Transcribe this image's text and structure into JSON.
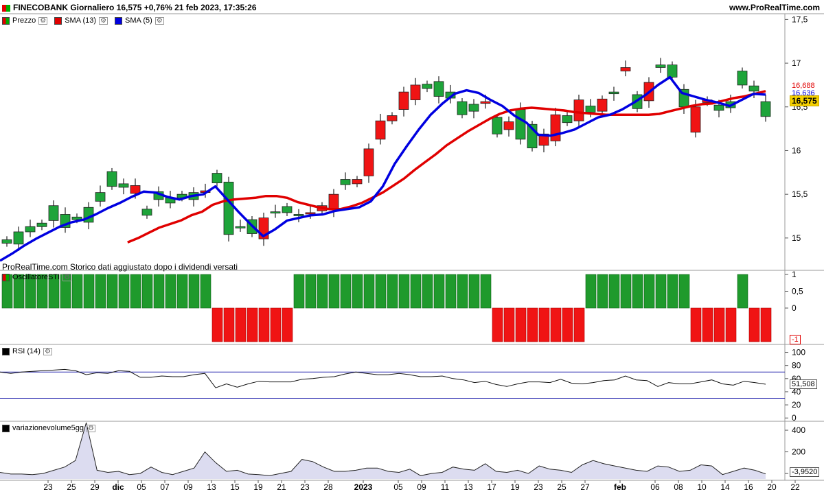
{
  "header": {
    "title": "FINECOBANK Giornaliero 16,575 +0,76% 21 feb 2023, 17:35:26",
    "site": "www.ProRealTime.com"
  },
  "legend": {
    "price": "Prezzo",
    "sma13": "SMA (13)",
    "sma5": "SMA (5)",
    "osc": "OscillatoreSTI",
    "rsi": "RSI (14)",
    "vol": "variazionevolume5gg"
  },
  "note": "ProRealTime.com  Storico dati aggiustato dopo i dividendi versati",
  "tags": {
    "sma13": "16,688",
    "sma5": "16,636",
    "last": "16,575",
    "osc": "-1",
    "rsi": "51,508",
    "vol": "-3,9520"
  },
  "chart_data": [
    {
      "type": "candlestick",
      "ylim": [
        14.63,
        17.55
      ],
      "yticks": [
        "17,5",
        "17",
        "16,5",
        "16",
        "15,5",
        "15"
      ],
      "ytick_values": [
        17.5,
        17.0,
        16.5,
        16.0,
        15.5,
        15.0
      ],
      "x_labels": [
        {
          "i": 2,
          "text": "23"
        },
        {
          "i": 4,
          "text": "25"
        },
        {
          "i": 6,
          "text": "29"
        },
        {
          "i": 8,
          "text": "dic",
          "bold": true
        },
        {
          "i": 10,
          "text": "05"
        },
        {
          "i": 12,
          "text": "07"
        },
        {
          "i": 14,
          "text": "09"
        },
        {
          "i": 16,
          "text": "13"
        },
        {
          "i": 18,
          "text": "15"
        },
        {
          "i": 20,
          "text": "19"
        },
        {
          "i": 22,
          "text": "21"
        },
        {
          "i": 24,
          "text": "23"
        },
        {
          "i": 26,
          "text": "28"
        },
        {
          "i": 29,
          "text": "2023",
          "bold": true
        },
        {
          "i": 32,
          "text": "05"
        },
        {
          "i": 34,
          "text": "09"
        },
        {
          "i": 36,
          "text": "11"
        },
        {
          "i": 38,
          "text": "13"
        },
        {
          "i": 40,
          "text": "17"
        },
        {
          "i": 42,
          "text": "19"
        },
        {
          "i": 44,
          "text": "23"
        },
        {
          "i": 46,
          "text": "25"
        },
        {
          "i": 48,
          "text": "27"
        },
        {
          "i": 51,
          "text": "feb",
          "bold": true
        },
        {
          "i": 54,
          "text": "06"
        },
        {
          "i": 56,
          "text": "08"
        },
        {
          "i": 58,
          "text": "10"
        },
        {
          "i": 60,
          "text": "14"
        },
        {
          "i": 62,
          "text": "16"
        },
        {
          "i": 64,
          "text": "20"
        },
        {
          "i": 66,
          "text": "22"
        }
      ],
      "open": [
        14.94,
        14.93,
        15.07,
        15.13,
        15.2,
        15.12,
        15.21,
        15.18,
        15.42,
        15.59,
        15.58,
        15.6,
        15.26,
        15.44,
        15.4,
        15.46,
        15.44,
        15.54,
        15.63,
        15.04,
        15.13,
        15.05,
        15.23,
        15.29,
        15.29,
        15.26,
        15.29,
        15.37,
        15.5,
        15.61,
        15.67,
        16.02,
        16.34,
        16.4,
        16.67,
        16.75,
        16.71,
        16.62,
        16.6,
        16.41,
        16.45,
        16.56,
        16.19,
        16.33,
        16.13,
        16.03,
        16.19,
        16.41,
        16.32,
        16.58,
        16.44,
        16.59,
        16.65,
        16.95,
        16.48,
        16.78,
        16.95,
        16.84,
        16.5,
        16.5,
        16.58,
        16.46,
        16.49,
        16.75,
        16.68,
        16.39
      ],
      "close": [
        14.98,
        15.07,
        15.13,
        15.17,
        15.37,
        15.27,
        15.24,
        15.35,
        15.52,
        15.76,
        15.62,
        15.51,
        15.33,
        15.53,
        15.46,
        15.5,
        15.52,
        15.52,
        15.74,
        15.64,
        15.13,
        15.21,
        14.99,
        15.3,
        15.36,
        15.27,
        15.28,
        15.31,
        15.32,
        15.67,
        15.62,
        15.71,
        16.13,
        16.34,
        16.47,
        16.58,
        16.76,
        16.79,
        16.67,
        16.56,
        16.53,
        16.54,
        16.38,
        16.24,
        16.47,
        16.3,
        16.06,
        16.11,
        16.4,
        16.34,
        16.51,
        16.45,
        16.67,
        16.91,
        16.64,
        16.57,
        16.98,
        16.98,
        16.7,
        16.21,
        16.55,
        16.52,
        16.56,
        16.91,
        16.74,
        16.56,
        16.41,
        16.57
      ]
    },
    {
      "type": "line",
      "series": [
        {
          "name": "SMA (13)",
          "color": "#e00000",
          "values": [
            null,
            null,
            null,
            null,
            null,
            null,
            null,
            null,
            null,
            null,
            null,
            null,
            14.95,
            15.0,
            15.06,
            15.12,
            15.16,
            15.2,
            15.26,
            15.3,
            15.38,
            15.42,
            15.44,
            15.45,
            15.46,
            15.48,
            15.48,
            15.46,
            15.41,
            15.38,
            15.35,
            15.33,
            15.33,
            15.36,
            15.4,
            15.46,
            15.52,
            15.6,
            15.68,
            15.78,
            15.87,
            15.96,
            16.06,
            16.14,
            16.22,
            16.29,
            16.36,
            16.42,
            16.46,
            16.48,
            16.49,
            16.48,
            16.47,
            16.46,
            16.44,
            16.43,
            16.42,
            16.41,
            16.41,
            16.41,
            16.41,
            16.41,
            16.42,
            16.45,
            16.48,
            16.51,
            16.53,
            16.54,
            16.57,
            16.6,
            16.62,
            16.65,
            16.68
          ]
        },
        {
          "name": "SMA (5)",
          "color": "#0000e0",
          "values": [
            14.74,
            14.82,
            14.91,
            14.99,
            15.06,
            15.13,
            15.18,
            15.21,
            15.27,
            15.34,
            15.4,
            15.47,
            15.53,
            15.52,
            15.47,
            15.44,
            15.48,
            15.5,
            15.59,
            15.44,
            15.29,
            15.15,
            15.02,
            15.1,
            15.2,
            15.23,
            15.26,
            15.27,
            15.31,
            15.33,
            15.35,
            15.42,
            15.59,
            15.85,
            16.05,
            16.24,
            16.41,
            16.54,
            16.65,
            16.69,
            16.66,
            16.58,
            16.51,
            16.4,
            16.32,
            16.18,
            16.17,
            16.2,
            16.24,
            16.31,
            16.38,
            16.41,
            16.47,
            16.55,
            16.64,
            16.75,
            16.84,
            16.66,
            16.62,
            16.58,
            16.55,
            16.51,
            16.58,
            16.65,
            16.64
          ]
        }
      ]
    },
    {
      "type": "bar",
      "title": "OscillatoreSTI",
      "ylim": [
        -1.1,
        1.1
      ],
      "yticks": [
        "1",
        "0,5",
        "0"
      ],
      "ytick_values": [
        1,
        0.5,
        0
      ],
      "values": [
        1,
        1,
        1,
        1,
        1,
        1,
        1,
        1,
        1,
        1,
        1,
        1,
        1,
        1,
        1,
        1,
        1,
        1,
        -1,
        -1,
        -1,
        -1,
        -1,
        -1,
        -1,
        1,
        1,
        1,
        1,
        1,
        1,
        1,
        1,
        1,
        1,
        1,
        1,
        1,
        1,
        1,
        1,
        1,
        -1,
        -1,
        -1,
        -1,
        -1,
        -1,
        -1,
        -1,
        1,
        1,
        1,
        1,
        1,
        1,
        1,
        1,
        1,
        -1,
        -1,
        -1,
        -1,
        1,
        -1,
        -1
      ]
    },
    {
      "type": "line",
      "title": "RSI (14)",
      "ylim": [
        -5,
        110
      ],
      "levels": [
        70,
        30
      ],
      "yticks": [
        "100",
        "80",
        "60",
        "40",
        "20",
        "0"
      ],
      "ytick_values": [
        100,
        80,
        60,
        40,
        20,
        0
      ],
      "values": [
        70,
        68,
        70,
        71,
        72,
        73,
        74,
        72,
        66,
        69,
        68,
        72,
        71,
        62,
        62,
        64,
        63,
        63,
        66,
        68,
        46,
        52,
        47,
        52,
        56,
        55,
        55,
        55,
        59,
        60,
        62,
        63,
        67,
        70,
        68,
        66,
        66,
        68,
        66,
        63,
        63,
        64,
        60,
        58,
        54,
        56,
        51,
        48,
        52,
        55,
        55,
        54,
        59,
        53,
        52,
        54,
        57,
        58,
        64,
        58,
        57,
        48,
        54,
        52,
        52,
        55,
        58,
        52,
        50,
        56,
        54,
        51.5
      ]
    },
    {
      "type": "area",
      "title": "variazionevolume5gg",
      "ylim": [
        -50,
        470
      ],
      "yticks": [
        "400",
        "200",
        "0"
      ],
      "ytick_values": [
        400,
        200,
        0
      ],
      "values": [
        10,
        -5,
        -5,
        -10,
        0,
        30,
        60,
        120,
        470,
        30,
        10,
        20,
        -10,
        0,
        60,
        10,
        -10,
        20,
        50,
        200,
        100,
        20,
        30,
        -5,
        -10,
        -20,
        0,
        20,
        130,
        110,
        60,
        20,
        20,
        30,
        50,
        50,
        20,
        10,
        40,
        -20,
        0,
        10,
        60,
        40,
        30,
        90,
        20,
        10,
        30,
        0,
        70,
        40,
        30,
        10,
        80,
        120,
        90,
        70,
        50,
        30,
        20,
        70,
        60,
        20,
        30,
        80,
        70,
        -10,
        20,
        50,
        30,
        -3.952
      ]
    }
  ]
}
